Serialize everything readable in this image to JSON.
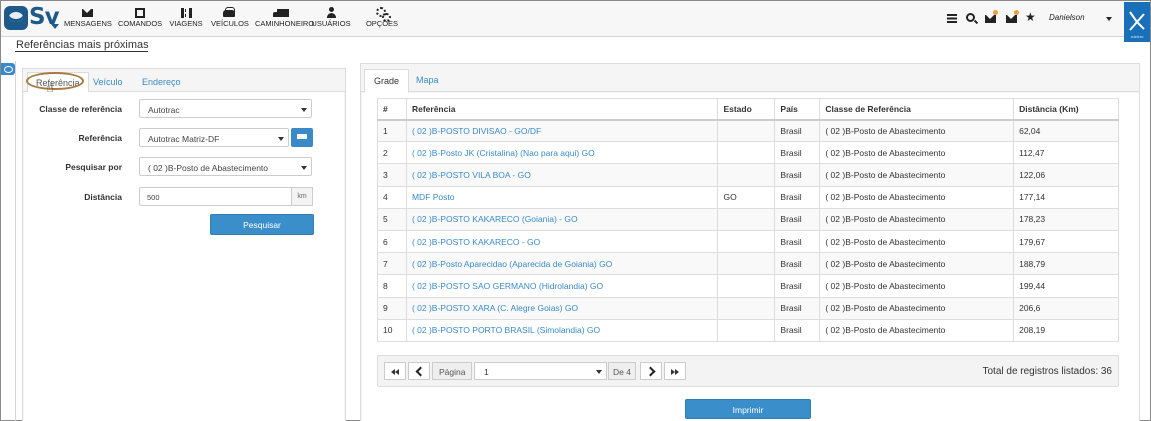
{
  "app": {
    "logo_text": "Sv",
    "nav": [
      {
        "label": "MENSAGENS",
        "icon": "envelope-icon"
      },
      {
        "label": "COMANDOS",
        "icon": "command-icon"
      },
      {
        "label": "VIAGENS",
        "icon": "road-icon"
      },
      {
        "label": "VEÍCULOS",
        "icon": "car-icon"
      },
      {
        "label": "CAMINHONEIRO",
        "icon": "truck-icon"
      },
      {
        "label": "USUÁRIOS",
        "icon": "user-icon"
      },
      {
        "label": "OPÇÕES",
        "icon": "gears-icon"
      }
    ],
    "user_name": "Danielson",
    "brand_text": "autotrac"
  },
  "page": {
    "title": "Referências mais próximas"
  },
  "left_panel": {
    "tabs": [
      "Referência",
      "Veículo",
      "Endereço"
    ],
    "active_tab": "Referência",
    "fields": {
      "classe_label": "Classe de referência",
      "classe_value": "Autotrac",
      "referencia_label": "Referência",
      "referencia_value": "Autotrac Matriz-DF",
      "pesquisar_label": "Pesquisar por",
      "pesquisar_value": "( 02 )B-Posto de Abastecimento",
      "distancia_label": "Distância",
      "distancia_value": "500",
      "distancia_unit": "km"
    },
    "search_button": "Pesquisar"
  },
  "right_panel": {
    "tabs": [
      "Grade",
      "Mapa"
    ],
    "active_tab": "Grade",
    "table": {
      "columns": [
        "#",
        "Referência",
        "Estado",
        "País",
        "Classe de Referência",
        "Distância (Km)"
      ],
      "rows": [
        [
          "1",
          "( 02 )B-POSTO DIVISAO - GO/DF",
          "",
          "Brasil",
          "( 02 )B-Posto de Abastecimento",
          "62,04"
        ],
        [
          "2",
          "( 02 )B-Posto JK (Cristalina) (Nao para aqui) GO",
          "",
          "Brasil",
          "( 02 )B-Posto de Abastecimento",
          "112,47"
        ],
        [
          "3",
          "( 02 )B-POSTO VILA BOA - GO",
          "",
          "Brasil",
          "( 02 )B-Posto de Abastecimento",
          "122,06"
        ],
        [
          "4",
          "MDF Posto",
          "GO",
          "Brasil",
          "( 02 )B-Posto de Abastecimento",
          "177,14"
        ],
        [
          "5",
          "( 02 )B-POSTO KAKARECO (Goiania) - GO",
          "",
          "Brasil",
          "( 02 )B-Posto de Abastecimento",
          "178,23"
        ],
        [
          "6",
          "( 02 )B-POSTO KAKARECO - GO",
          "",
          "Brasil",
          "( 02 )B-Posto de Abastecimento",
          "179,67"
        ],
        [
          "7",
          "( 02 )B-Posto Aparecidao (Aparecida de Goiania) GO",
          "",
          "Brasil",
          "( 02 )B-Posto de Abastecimento",
          "188,79"
        ],
        [
          "8",
          "( 02 )B-POSTO SAO GERMANO (Hidrolandia) GO",
          "",
          "Brasil",
          "( 02 )B-Posto de Abastecimento",
          "199,44"
        ],
        [
          "9",
          "( 02 )B-POSTO XARA (C. Alegre Goias) GO",
          "",
          "Brasil",
          "( 02 )B-Posto de Abastecimento",
          "206,6"
        ],
        [
          "10",
          "( 02 )B-POSTO PORTO BRASIL (Simolandia) GO",
          "",
          "Brasil",
          "( 02 )B-Posto de Abastecimento",
          "208,19"
        ]
      ]
    },
    "pager": {
      "page_label": "Página",
      "page_value": "1",
      "of_label": "De 4",
      "total_text": "Total de registros listados: 36"
    },
    "print_button": "Imprimir"
  }
}
